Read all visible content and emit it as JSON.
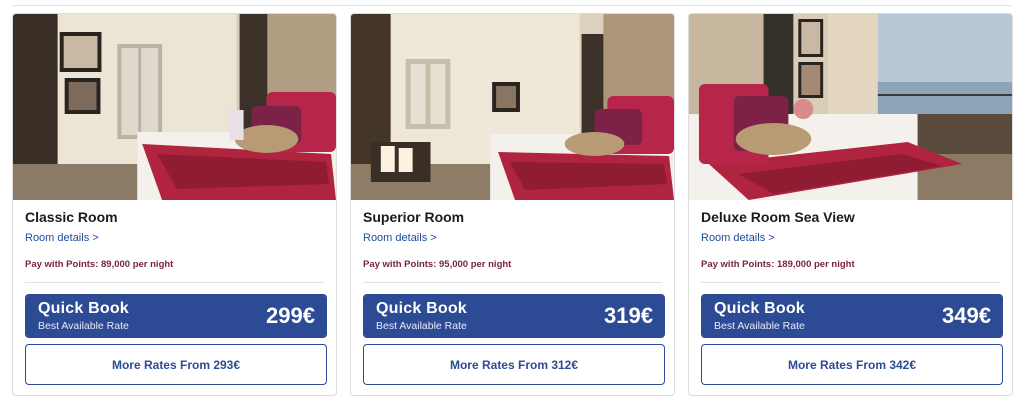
{
  "rooms": [
    {
      "name": "Classic Room",
      "details_link": "Room details >",
      "points": "Pay with Points: 89,000 per night",
      "quick_book_title": "Quick Book",
      "quick_book_subtitle": "Best Available Rate",
      "quick_book_price": "299€",
      "more_rates": "More Rates From 293€"
    },
    {
      "name": "Superior Room",
      "details_link": "Room details >",
      "points": "Pay with Points: 95,000 per night",
      "quick_book_title": "Quick Book",
      "quick_book_subtitle": "Best Available Rate",
      "quick_book_price": "319€",
      "more_rates": "More Rates From 312€"
    },
    {
      "name": "Deluxe Room Sea View",
      "details_link": "Room details >",
      "points": "Pay with Points: 189,000 per night",
      "quick_book_title": "Quick Book",
      "quick_book_subtitle": "Best Available Rate",
      "quick_book_price": "349€",
      "more_rates": "More Rates From 342€"
    }
  ],
  "colors": {
    "primary_blue": "#2d4a94",
    "link_blue": "#1f4a9c",
    "points_text": "#7a2340",
    "bedspread_red": "#b0243f"
  }
}
